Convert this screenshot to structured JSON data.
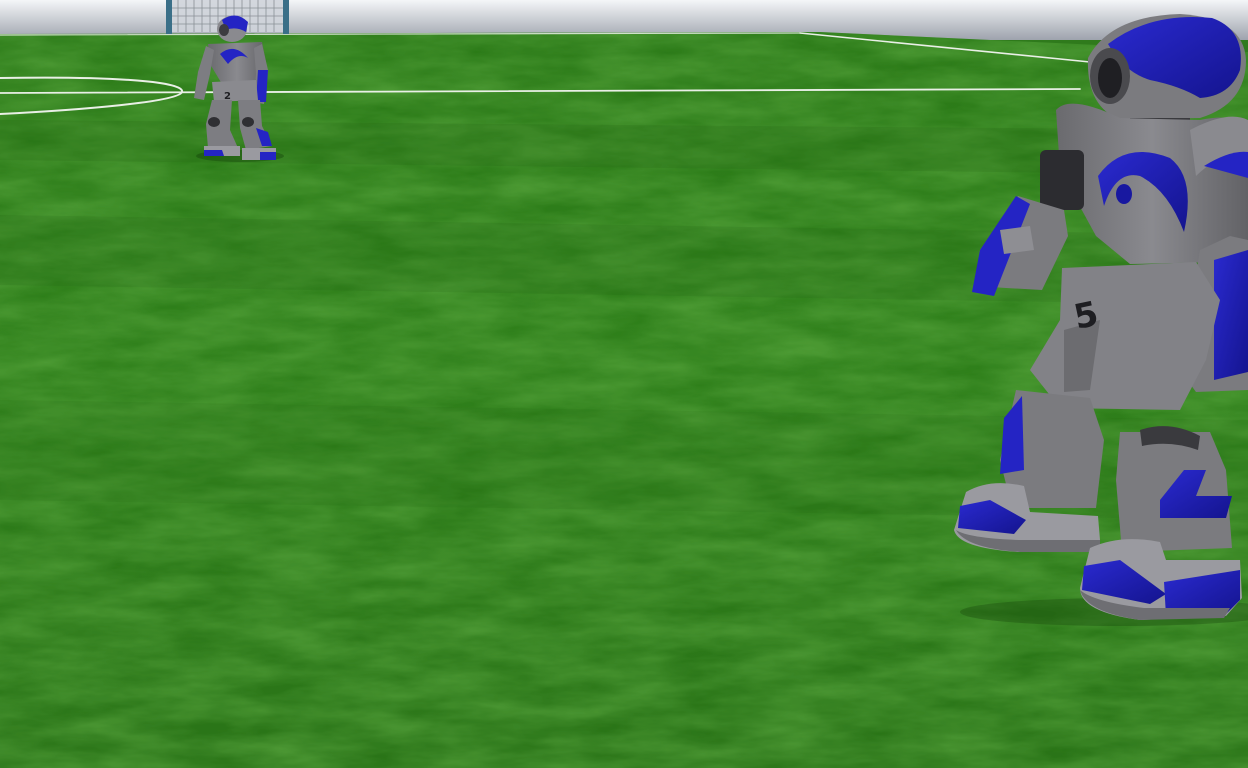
{
  "scene": {
    "title": "",
    "colors": {
      "sky_top": "#f4f6f8",
      "sky_bottom": "#9ea3ad",
      "grass_light": "#3f9a26",
      "grass_dark": "#1f5f12",
      "field_line": "#e9efe6",
      "robot_body": "#7b7b7f",
      "robot_shadow": "#4d4d52",
      "robot_accent": "#1f1fb8"
    }
  },
  "players": {
    "far": {
      "number": "2"
    },
    "near": {
      "number": "5"
    }
  }
}
